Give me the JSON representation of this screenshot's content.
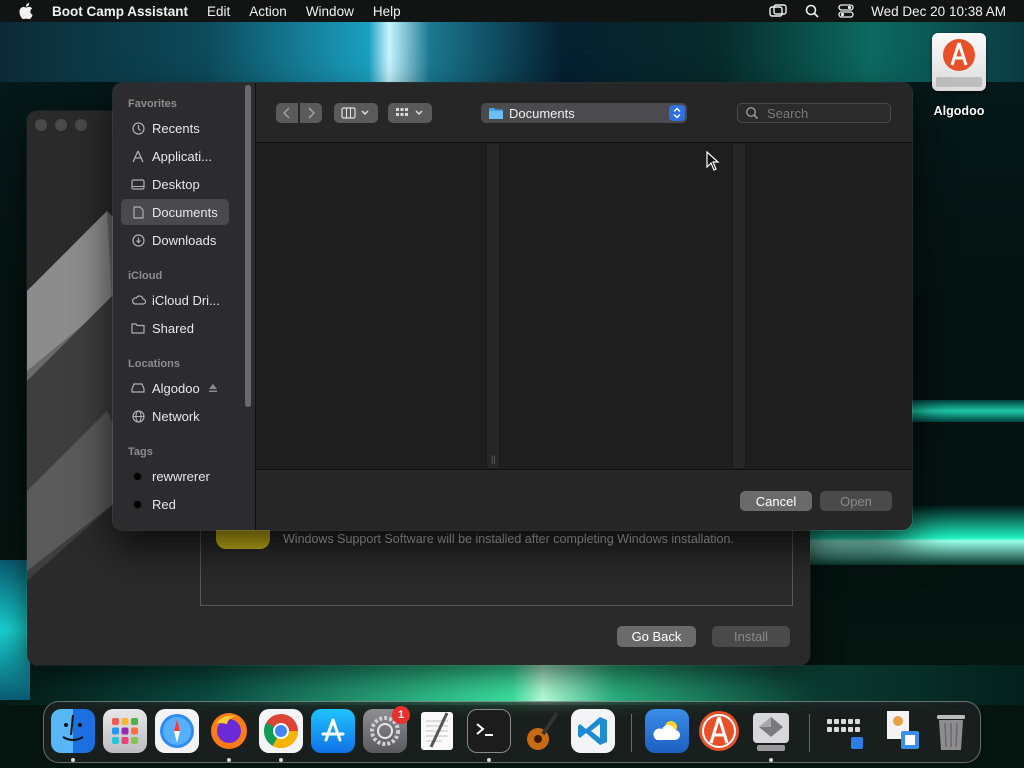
{
  "menubar": {
    "app_name": "Boot Camp Assistant",
    "items": [
      "Edit",
      "Action",
      "Window",
      "Help"
    ],
    "clock": "Wed Dec 20  10:38 AM"
  },
  "desktop": {
    "icons": [
      {
        "label": "Algodoo",
        "icon": "drive-icon"
      }
    ]
  },
  "bootcamp": {
    "message": "Windows Support Software will be installed after completing Windows installation.",
    "go_back": "Go Back",
    "install": "Install"
  },
  "dialog": {
    "sidebar": {
      "favorites_header": "Favorites",
      "favorites": [
        {
          "label": "Recents",
          "icon": "clock-icon"
        },
        {
          "label": "Applicati...",
          "icon": "applications-icon"
        },
        {
          "label": "Desktop",
          "icon": "desktop-icon"
        },
        {
          "label": "Documents",
          "icon": "document-icon",
          "selected": true
        },
        {
          "label": "Downloads",
          "icon": "download-icon"
        }
      ],
      "icloud_header": "iCloud",
      "icloud": [
        {
          "label": "iCloud Dri...",
          "icon": "cloud-icon"
        },
        {
          "label": "Shared",
          "icon": "shared-folder-icon"
        }
      ],
      "locations_header": "Locations",
      "locations": [
        {
          "label": "Algodoo",
          "icon": "drive-icon"
        },
        {
          "label": "Network",
          "icon": "globe-icon"
        }
      ],
      "tags_header": "Tags",
      "tags": [
        {
          "label": "rewwrerer",
          "color": "#000000"
        },
        {
          "label": "Red",
          "color": "#000000"
        }
      ]
    },
    "location": "Documents",
    "search_placeholder": "Search",
    "cancel": "Cancel",
    "open": "Open"
  },
  "dock": {
    "apps": [
      {
        "name": "Finder",
        "icon": "finder-icon",
        "running": true
      },
      {
        "name": "Launchpad",
        "icon": "launchpad-icon",
        "running": false
      },
      {
        "name": "Safari",
        "icon": "safari-icon",
        "running": false
      },
      {
        "name": "Firefox",
        "icon": "firefox-icon",
        "running": true
      },
      {
        "name": "Chrome",
        "icon": "chrome-icon",
        "running": true
      },
      {
        "name": "App Store",
        "icon": "app-store-icon",
        "running": false
      },
      {
        "name": "System Settings",
        "icon": "settings-icon",
        "running": false,
        "badge": "1"
      },
      {
        "name": "TextEdit",
        "icon": "textedit-icon",
        "running": false
      },
      {
        "name": "Terminal",
        "icon": "terminal-icon",
        "running": true
      },
      {
        "name": "GarageBand",
        "icon": "guitar-icon",
        "running": false
      },
      {
        "name": "Visual Studio Code",
        "icon": "vscode-icon",
        "running": false
      },
      {
        "name": "Weather",
        "icon": "weather-icon",
        "running": false
      },
      {
        "name": "Algodoo",
        "icon": "algodoo-icon",
        "running": false
      },
      {
        "name": "Boot Camp Assistant",
        "icon": "bootcamp-icon",
        "running": true
      },
      {
        "name": "Applications",
        "icon": "apps-folder-icon",
        "running": false
      },
      {
        "name": "Downloads Stack",
        "icon": "downloads-stack-icon",
        "running": false
      },
      {
        "name": "Trash",
        "icon": "trash-icon",
        "running": false
      }
    ]
  }
}
